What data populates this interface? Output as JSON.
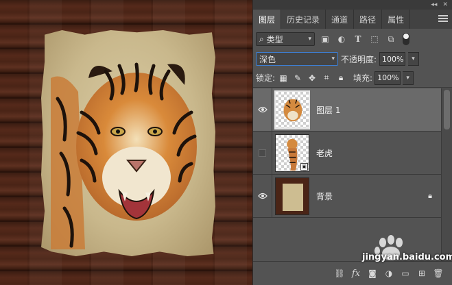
{
  "panel": {
    "tabs": [
      {
        "label": "图层",
        "active": true
      },
      {
        "label": "历史记录",
        "active": false
      },
      {
        "label": "通道",
        "active": false
      },
      {
        "label": "路径",
        "active": false
      },
      {
        "label": "属性",
        "active": false
      }
    ],
    "filter": {
      "kind_label": "类型",
      "icons": [
        "image-filter-icon",
        "adjustment-filter-icon",
        "type-filter-icon",
        "shape-filter-icon",
        "smart-object-filter-icon"
      ]
    },
    "blend": {
      "mode": "深色",
      "opacity_label": "不透明度:",
      "opacity_value": "100%"
    },
    "lock": {
      "label": "锁定:",
      "fill_label": "填充:",
      "fill_value": "100%"
    },
    "layers": [
      {
        "name": "图层 1",
        "visible": true,
        "selected": true,
        "type": "pixel"
      },
      {
        "name": "老虎",
        "visible": false,
        "selected": false,
        "type": "smart-object"
      },
      {
        "name": "背景",
        "visible": true,
        "selected": false,
        "type": "background",
        "locked": true
      }
    ]
  },
  "watermark": {
    "url": "jingyan.baidu.com"
  },
  "colors": {
    "panel_bg": "#535353",
    "tab_bar": "#424242",
    "selected_layer": "#6a6a6a",
    "focus_blue": "#3d7fd4"
  }
}
